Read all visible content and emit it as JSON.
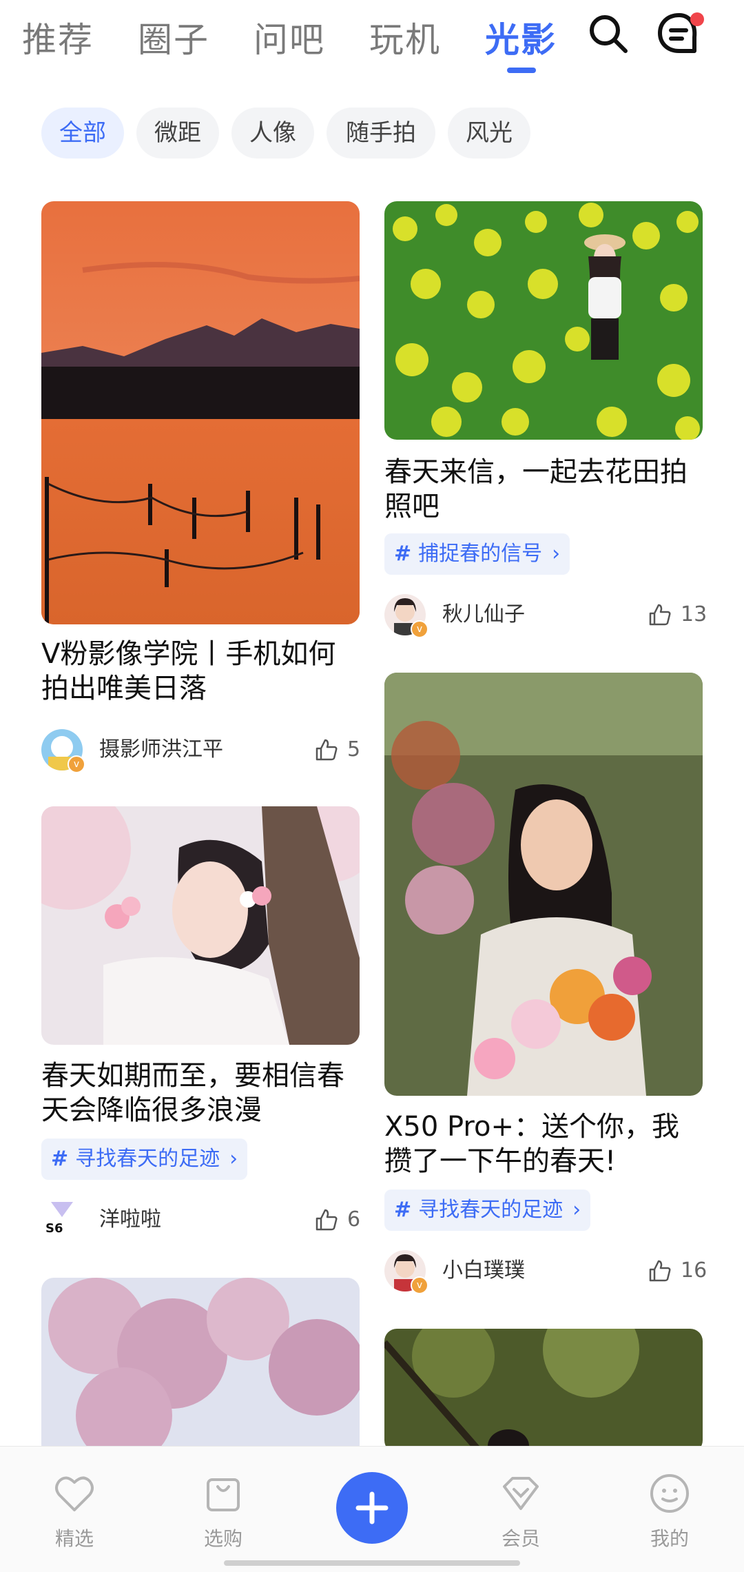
{
  "top_tabs": [
    "推荐",
    "圈子",
    "问吧",
    "玩机",
    "光影"
  ],
  "active_tab": "光影",
  "icons": {
    "search": "search-icon",
    "messages": "chat-icon"
  },
  "filters": [
    "全部",
    "微距",
    "人像",
    "随手拍",
    "风光"
  ],
  "active_filter": "全部",
  "posts": [
    {
      "title_l1": "V粉影像学院丨手机如何",
      "title_l2": "拍出唯美日落",
      "user": "摄影师洪江平",
      "likes": "5"
    },
    {
      "title_l1": "春天来信，一起去花田拍",
      "title_l2": "照吧",
      "topic": "捕捉春的信号",
      "user": "秋儿仙子",
      "likes": "13"
    },
    {
      "title_l1": "春天如期而至，要相信春",
      "title_l2": "天会降临很多浪漫",
      "topic": "寻找春天的足迹",
      "user": "洋啦啦",
      "likes": "6",
      "avatar_text": "S6"
    },
    {
      "title_l1": "X50 Pro+：送个你，我",
      "title_l2": "攒了一下午的春天!",
      "topic": "寻找春天的足迹",
      "user": "小白璞璞",
      "likes": "16"
    }
  ],
  "hash": "#",
  "bottom_nav": [
    "精选",
    "选购",
    "会员",
    "我的"
  ],
  "colors": {
    "accent": "#3d6cf5",
    "badge": "#f0a13b",
    "notify": "#f0444a"
  }
}
